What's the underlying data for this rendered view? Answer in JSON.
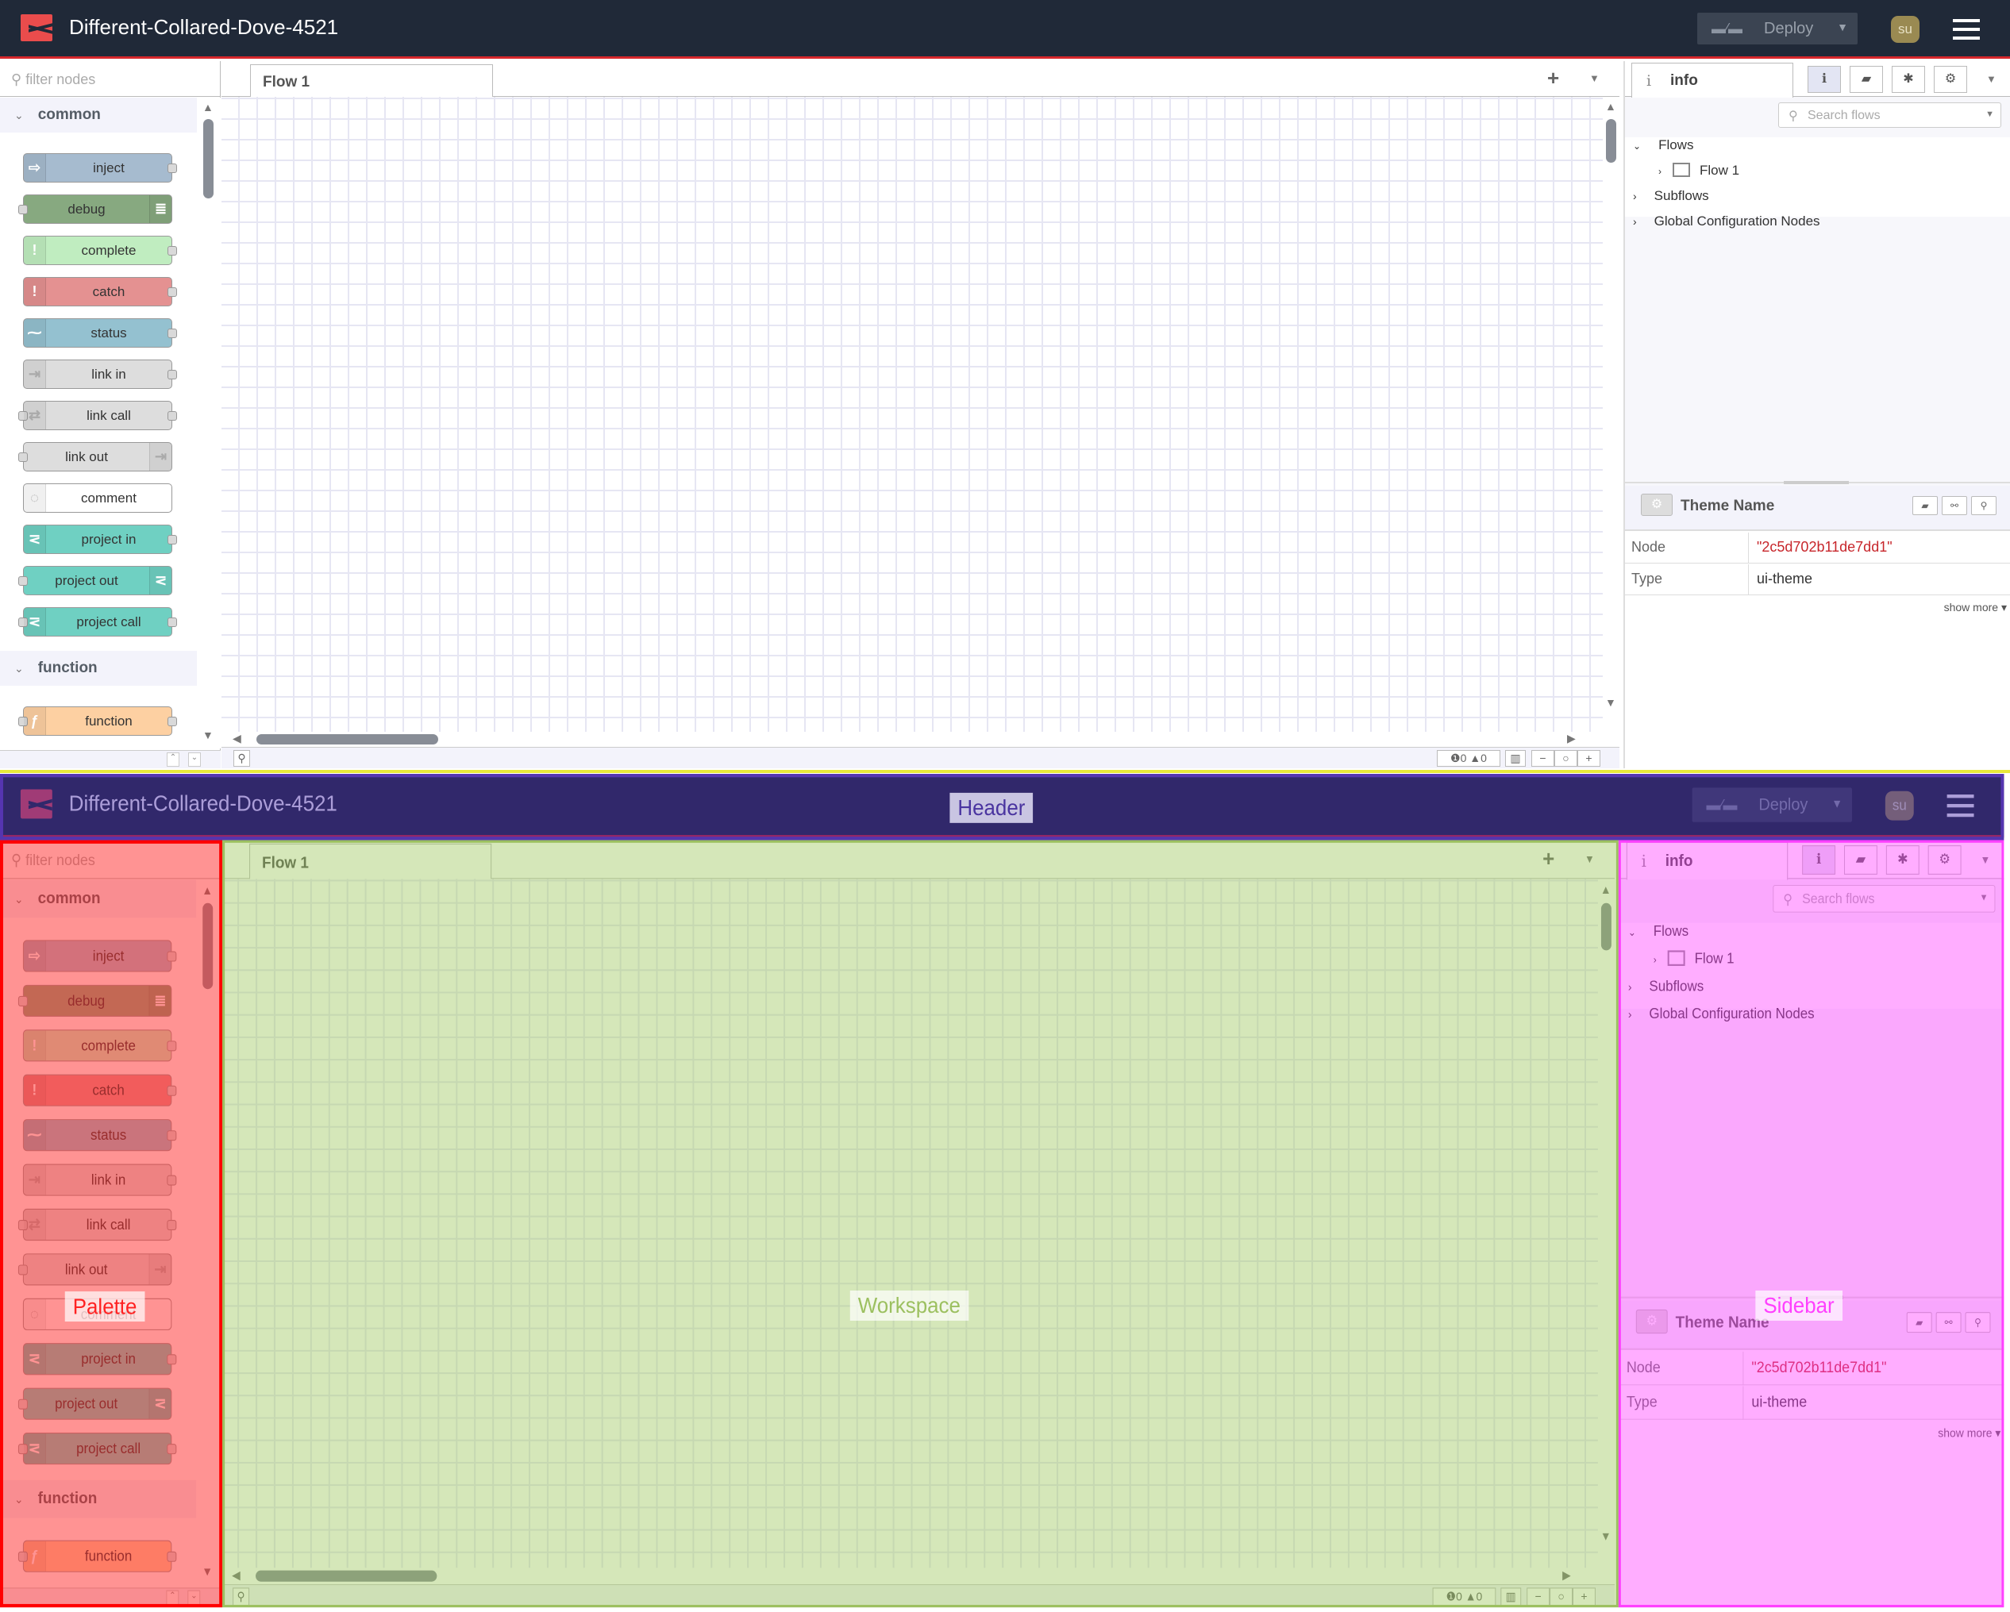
{
  "header": {
    "title": "Different-Collared-Dove-4521",
    "deploy_label": "Deploy",
    "user_initials": "su"
  },
  "palette": {
    "filter_placeholder": "filter nodes",
    "categories": [
      {
        "label": "common",
        "nodes": [
          {
            "label": "inject",
            "color": "#a6bbcf",
            "icon": "arrow-in-icon",
            "icon_side": "left",
            "input": false,
            "output": true
          },
          {
            "label": "debug",
            "color": "#87a980",
            "icon": "list-icon",
            "icon_side": "right",
            "input": true,
            "output": false
          },
          {
            "label": "complete",
            "color": "#c0edc0",
            "icon": "exclamation-icon",
            "icon_side": "left",
            "input": false,
            "output": true
          },
          {
            "label": "catch",
            "color": "#e49191",
            "icon": "exclamation-icon",
            "icon_side": "left",
            "input": false,
            "output": true
          },
          {
            "label": "status",
            "color": "#94c1d0",
            "icon": "pulse-icon",
            "icon_side": "left",
            "input": false,
            "output": true
          },
          {
            "label": "link in",
            "color": "#dddddd",
            "icon": "link-in-icon",
            "icon_side": "left",
            "input": false,
            "output": true
          },
          {
            "label": "link call",
            "color": "#dddddd",
            "icon": "link-call-icon",
            "icon_side": "left",
            "input": true,
            "output": true
          },
          {
            "label": "link out",
            "color": "#dddddd",
            "icon": "link-out-icon",
            "icon_side": "right",
            "input": true,
            "output": false
          },
          {
            "label": "comment",
            "color": "#ffffff",
            "icon": "comment-icon",
            "icon_side": "left",
            "input": false,
            "output": false
          },
          {
            "label": "project in",
            "color": "#6fd0c2",
            "icon": "project-icon",
            "icon_side": "left",
            "input": false,
            "output": true
          },
          {
            "label": "project out",
            "color": "#6fd0c2",
            "icon": "project-icon",
            "icon_side": "right",
            "input": true,
            "output": false
          },
          {
            "label": "project call",
            "color": "#6fd0c2",
            "icon": "project-icon",
            "icon_side": "left",
            "input": true,
            "output": true
          }
        ]
      },
      {
        "label": "function",
        "nodes": [
          {
            "label": "function",
            "color": "#fdd0a2",
            "icon": "function-icon",
            "icon_side": "left",
            "input": true,
            "output": true
          }
        ]
      }
    ]
  },
  "workspace": {
    "tabs": [
      {
        "label": "Flow 1"
      }
    ],
    "errors": "0",
    "warnings": "0"
  },
  "sidebar": {
    "active_tab": "info",
    "search_placeholder": "Search flows",
    "tree": {
      "flows": "Flows",
      "flow1": "Flow 1",
      "subflows": "Subflows",
      "global": "Global Configuration Nodes"
    },
    "properties": {
      "title": "Theme Name",
      "rows": [
        {
          "key": "Node",
          "value": "\"2c5d702b11de7dd1\""
        },
        {
          "key": "Type",
          "value": "ui-theme"
        }
      ],
      "show_more": "show more"
    }
  },
  "overlay_labels": {
    "header": "Header",
    "palette": "Palette",
    "workspace": "Workspace",
    "sidebar": "Sidebar"
  },
  "colors": {
    "header_bg": "#202938",
    "accent": "#d6272c",
    "overlay_header": "#3b2b8a",
    "overlay_palette": "#ff0000",
    "overlay_workspace": "#8cc04a",
    "overlay_sidebar": "#ff40ff"
  }
}
